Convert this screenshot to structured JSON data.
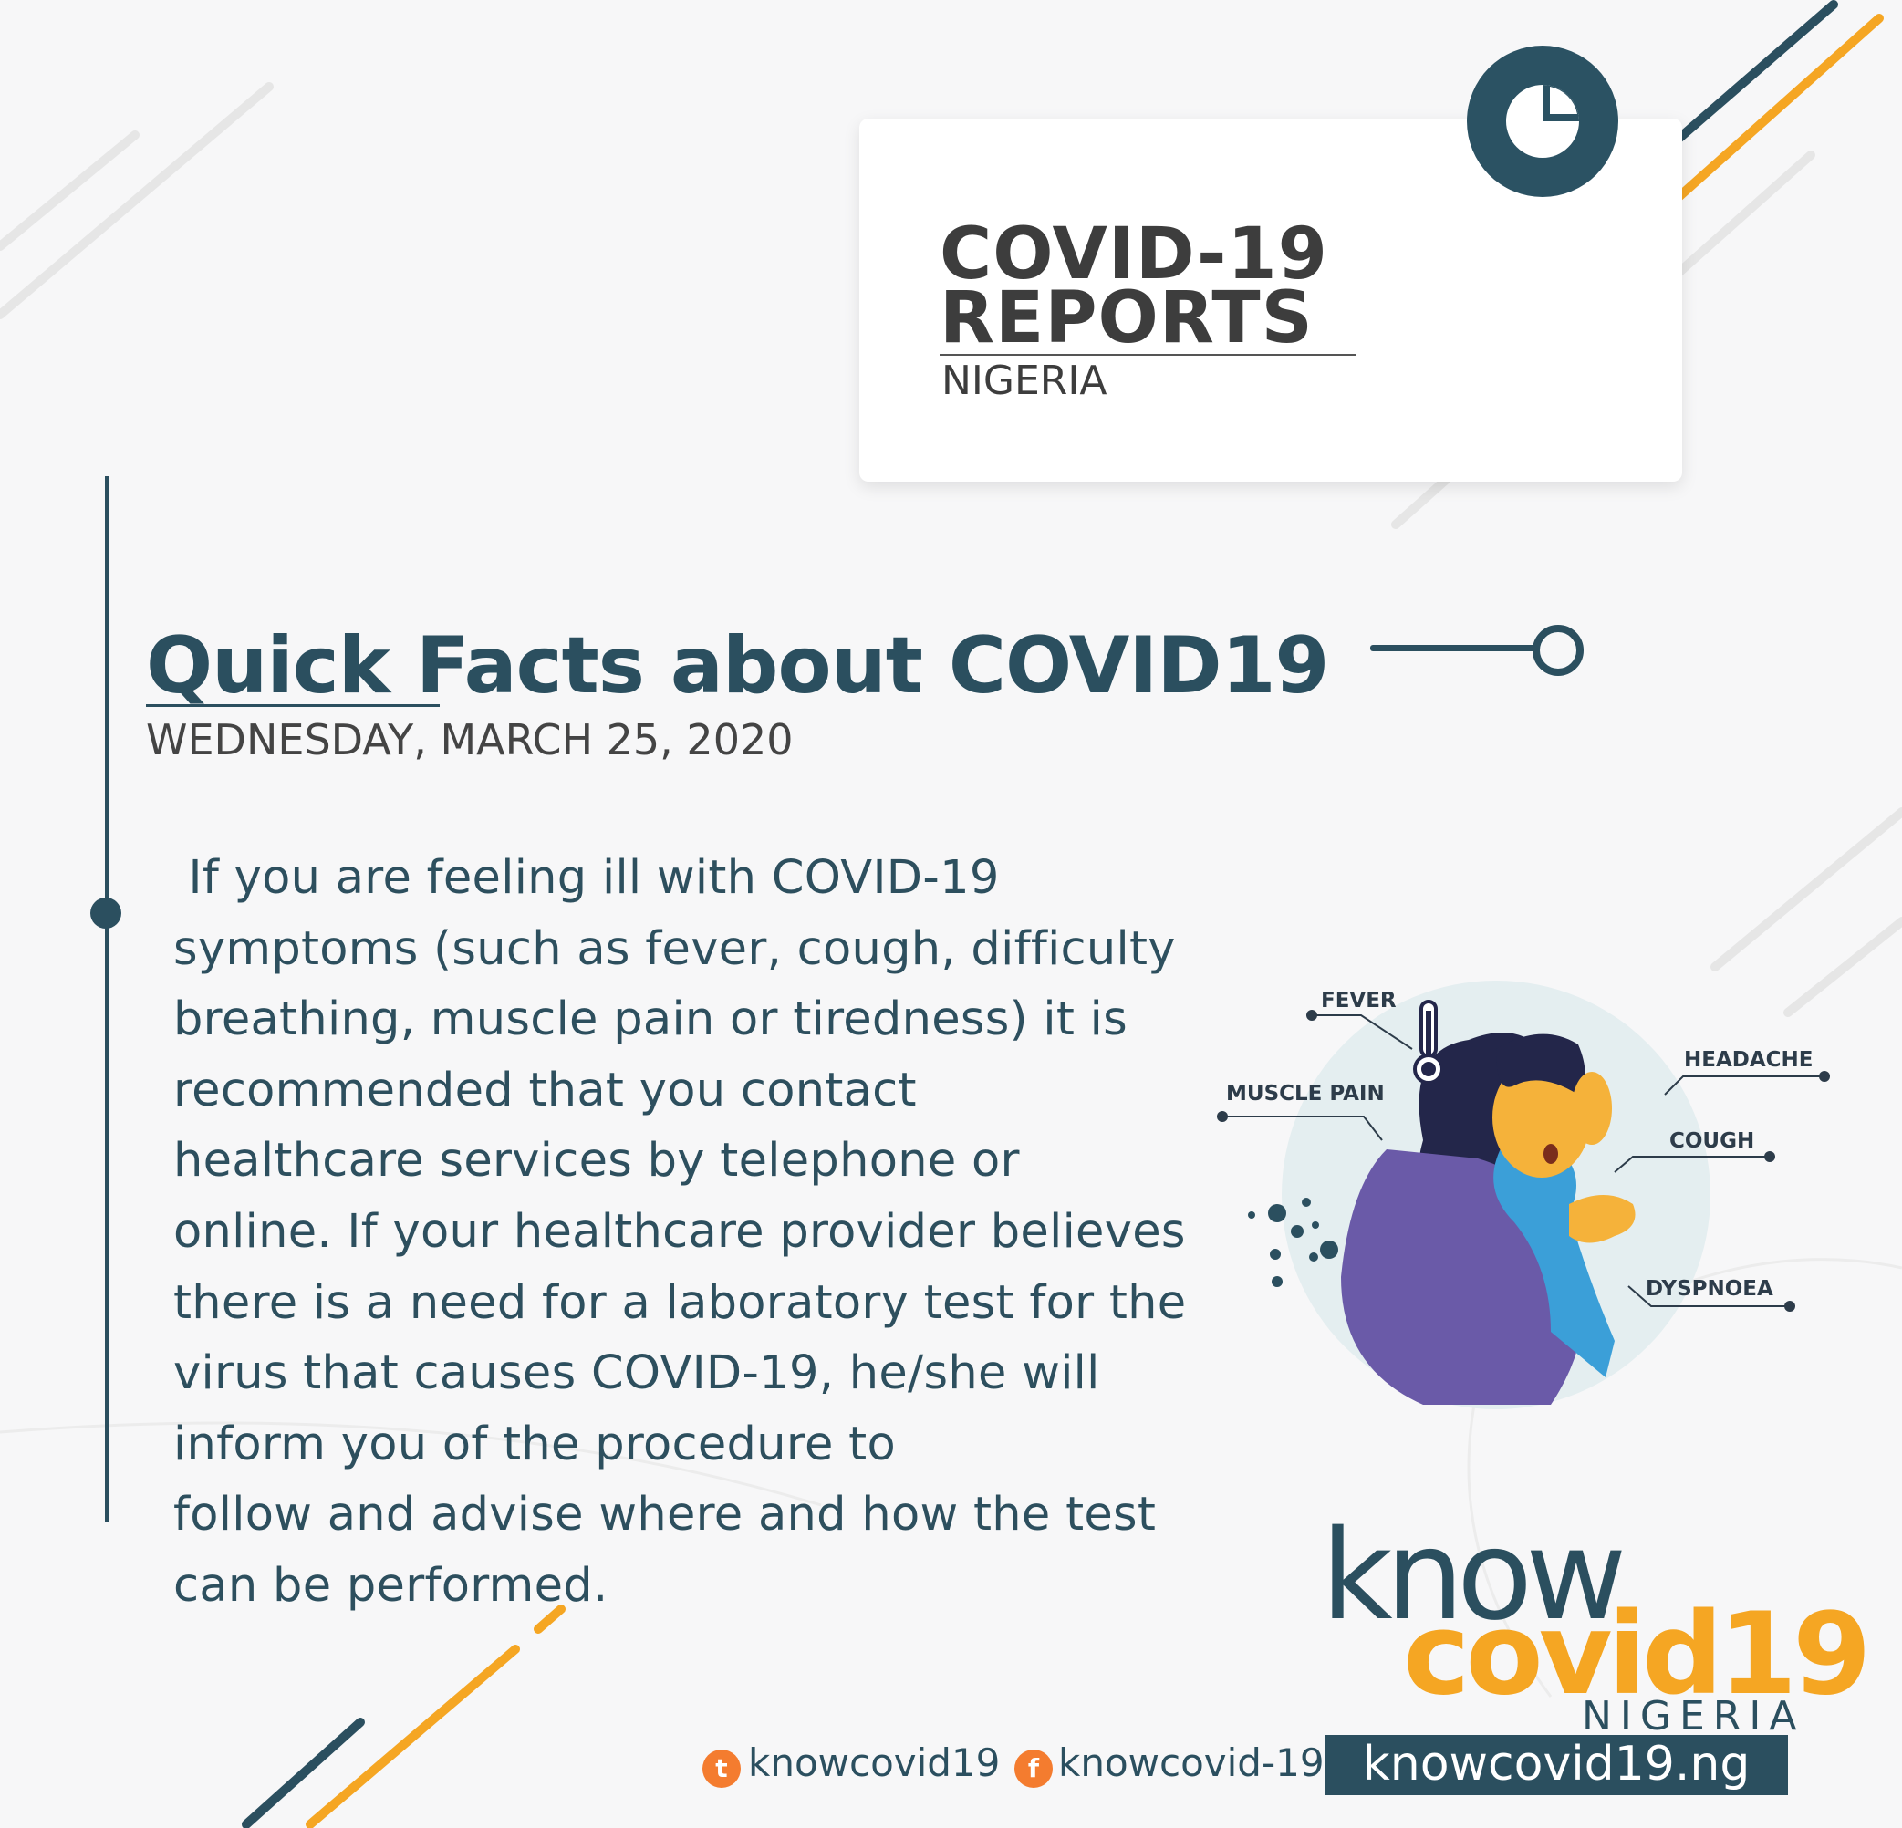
{
  "header": {
    "title_line1": "COVID-19",
    "title_line2": "REPORTS",
    "country": "NIGERIA"
  },
  "main": {
    "heading": "Quick Facts about COVID19",
    "date": "WEDNESDAY, MARCH 25, 2020",
    "body": " If you are feeling ill with COVID-19\nsymptoms (such as fever, cough, difficulty\nbreathing, muscle pain or tiredness) it is\nrecommended that you contact\nhealthcare services by telephone or\nonline. If your healthcare provider believes\nthere is a need for a laboratory test for the\nvirus that causes COVID-19, he/she will\ninform you of the procedure to\nfollow and advise where and how the test\ncan be performed."
  },
  "symptoms": {
    "fever": "FEVER",
    "headache": "HEADACHE",
    "muscle_pain": "MUSCLE PAIN",
    "cough": "COUGH",
    "dyspnoea": "DYSPNOEA"
  },
  "logo": {
    "know": "know",
    "covid": "covid19",
    "country": "NIGERIA"
  },
  "footer": {
    "twitter_handle": "knowcovid19",
    "facebook_handle": "knowcovid-19",
    "website": "knowcovid19.ng"
  },
  "icons": [
    "clock-pie-icon",
    "thermometer-icon",
    "twitter-icon",
    "facebook-icon",
    "virus-icon"
  ],
  "colors": {
    "navy": "#2b4f5f",
    "orange": "#f5a623",
    "social_orange": "#f47c2f",
    "background": "#f7f7f8",
    "purple": "#6a5aa8",
    "skin": "#f5b23a",
    "scarf": "#3b9fd8"
  }
}
